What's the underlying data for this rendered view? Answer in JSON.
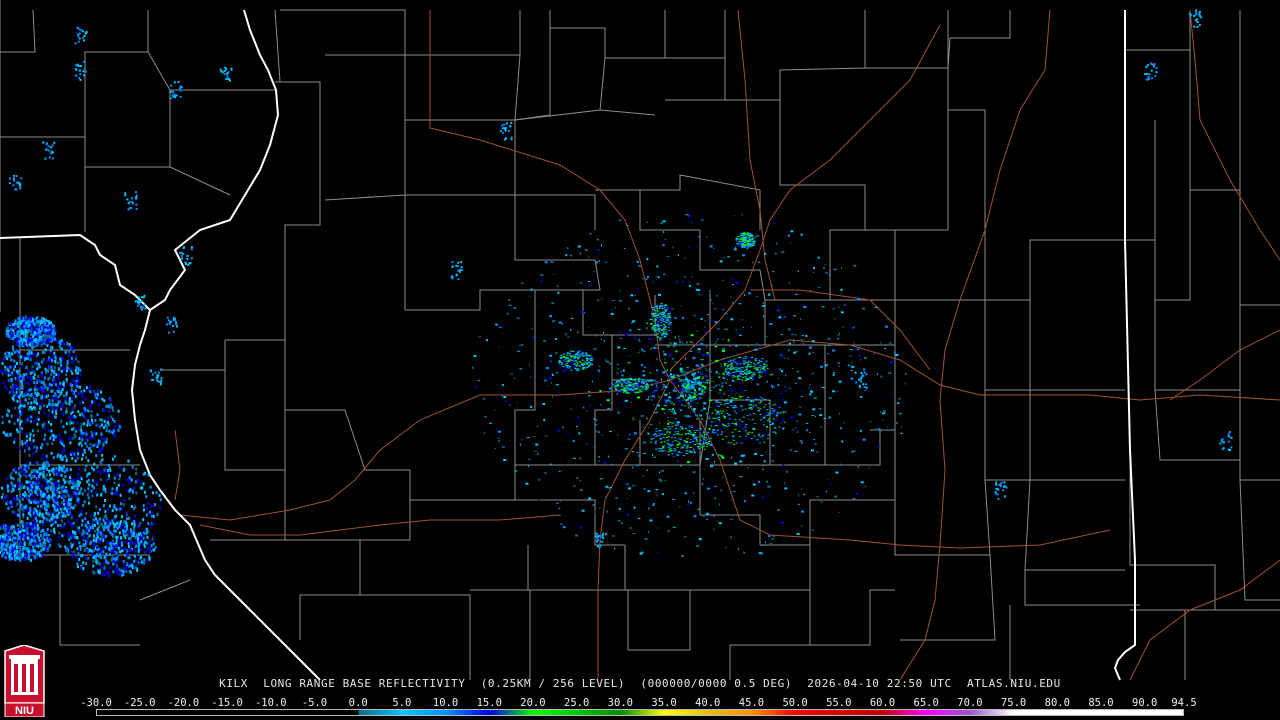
{
  "caption": {
    "station": "KILX",
    "product": "LONG RANGE BASE REFLECTIVITY",
    "resolution": "(0.25KM / 256 LEVEL)",
    "volume": "(000000/0000 0.5 DEG)",
    "datetime": "2026-04-10 22:50 UTC",
    "source": "ATLAS.NIU.EDU"
  },
  "logo": {
    "text": "NIU",
    "colors": {
      "red": "#c8102e",
      "white": "#ffffff"
    }
  },
  "scale": {
    "labels": [
      "-30.0",
      "-25.0",
      "-20.0",
      "-15.0",
      "-10.0",
      "-5.0",
      "0.0",
      "5.0",
      "10.0",
      "15.0",
      "20.0",
      "25.0",
      "30.0",
      "35.0",
      "40.0",
      "45.0",
      "50.0",
      "55.0",
      "60.0",
      "65.0",
      "70.0",
      "75.0",
      "80.0",
      "85.0",
      "90.0",
      "94.5"
    ],
    "min": -30,
    "max": 94.5,
    "stops": [
      {
        "v": -30,
        "c": "#000000"
      },
      {
        "v": 0,
        "c": "#000000"
      },
      {
        "v": 0.01,
        "c": "#0a6a8a"
      },
      {
        "v": 5,
        "c": "#00c8ff"
      },
      {
        "v": 10,
        "c": "#0090ff"
      },
      {
        "v": 15,
        "c": "#0000e6"
      },
      {
        "v": 20,
        "c": "#00ff00"
      },
      {
        "v": 25,
        "c": "#00c800"
      },
      {
        "v": 30,
        "c": "#008c00"
      },
      {
        "v": 35,
        "c": "#ffff00"
      },
      {
        "v": 40,
        "c": "#e7c000"
      },
      {
        "v": 45,
        "c": "#ff9000"
      },
      {
        "v": 50,
        "c": "#ff0000"
      },
      {
        "v": 55,
        "c": "#d60000"
      },
      {
        "v": 60,
        "c": "#c00000"
      },
      {
        "v": 65,
        "c": "#ff00ff"
      },
      {
        "v": 70,
        "c": "#9955c9"
      },
      {
        "v": 75,
        "c": "#ffffff"
      },
      {
        "v": 94.5,
        "c": "#ffffff"
      }
    ]
  },
  "map": {
    "colors": {
      "background": "#000000",
      "county_lines": "#8c8c8c",
      "state_lines": "#ffffff",
      "highways": "#a0522d"
    },
    "echo_colors": {
      "weak": "#0a6a8a",
      "light": "#00c8ff",
      "moderate": "#0090ff",
      "heavy": "#0000e6",
      "strong": "#00ff00"
    }
  }
}
